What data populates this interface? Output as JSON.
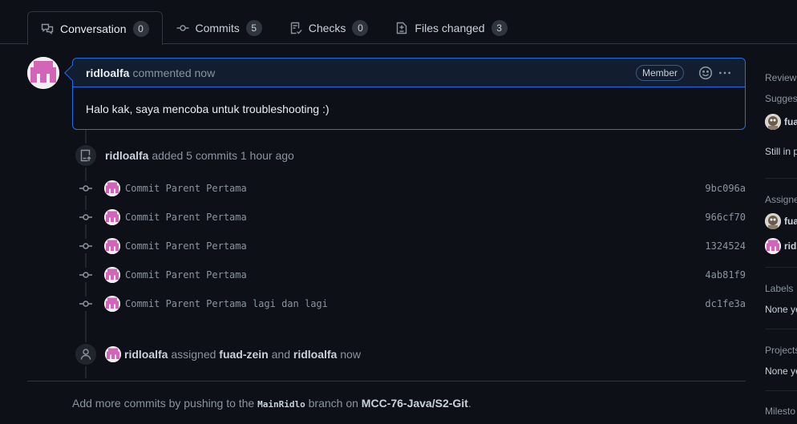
{
  "tabs": [
    {
      "label": "Conversation",
      "count": "0",
      "icon": "conversation-icon"
    },
    {
      "label": "Commits",
      "count": "5",
      "icon": "git-commit-icon"
    },
    {
      "label": "Checks",
      "count": "0",
      "icon": "checklist-icon"
    },
    {
      "label": "Files changed",
      "count": "3",
      "icon": "file-diff-icon"
    }
  ],
  "comment": {
    "author": "ridloalfa",
    "action": "commented now",
    "badge": "Member",
    "body": "Halo kak, saya mencoba untuk troubleshooting :)"
  },
  "commits_event": {
    "author": "ridloalfa",
    "text": "added 5 commits 1 hour ago"
  },
  "commits": [
    {
      "message": "Commit Parent Pertama",
      "sha": "9bc096a"
    },
    {
      "message": "Commit Parent Pertama",
      "sha": "966cf70"
    },
    {
      "message": "Commit Parent Pertama",
      "sha": "1324524"
    },
    {
      "message": "Commit Parent Pertama",
      "sha": "4ab81f9"
    },
    {
      "message": "Commit Parent Pertama lagi dan lagi",
      "sha": "dc1fe3a"
    }
  ],
  "assign_event": {
    "actor": "ridloalfa",
    "verb": "assigned",
    "assignee1": "fuad-zein",
    "conj": "and",
    "assignee2": "ridloalfa",
    "time": "now"
  },
  "footer": {
    "prefix": "Add more commits by pushing to the",
    "branch": "MainRidlo",
    "mid": "branch on",
    "repo": "MCC-76-Java/S2-Git",
    "suffix": "."
  },
  "sidebar": {
    "reviewers_heading": "Reviewe",
    "suggested": "Sugges",
    "reviewer_name": "fua",
    "still_text": "Still in p",
    "assignees_heading": "Assigne",
    "assignee1": "fua",
    "assignee2": "ridl",
    "labels_heading": "Labels",
    "labels_value": "None ye",
    "projects_heading": "Projects",
    "projects_value": "None ye",
    "milestone_heading": "Milesto"
  },
  "colors": {
    "accent": "#1f6feb",
    "background": "#0d1117",
    "identicon": "#d265b8"
  }
}
